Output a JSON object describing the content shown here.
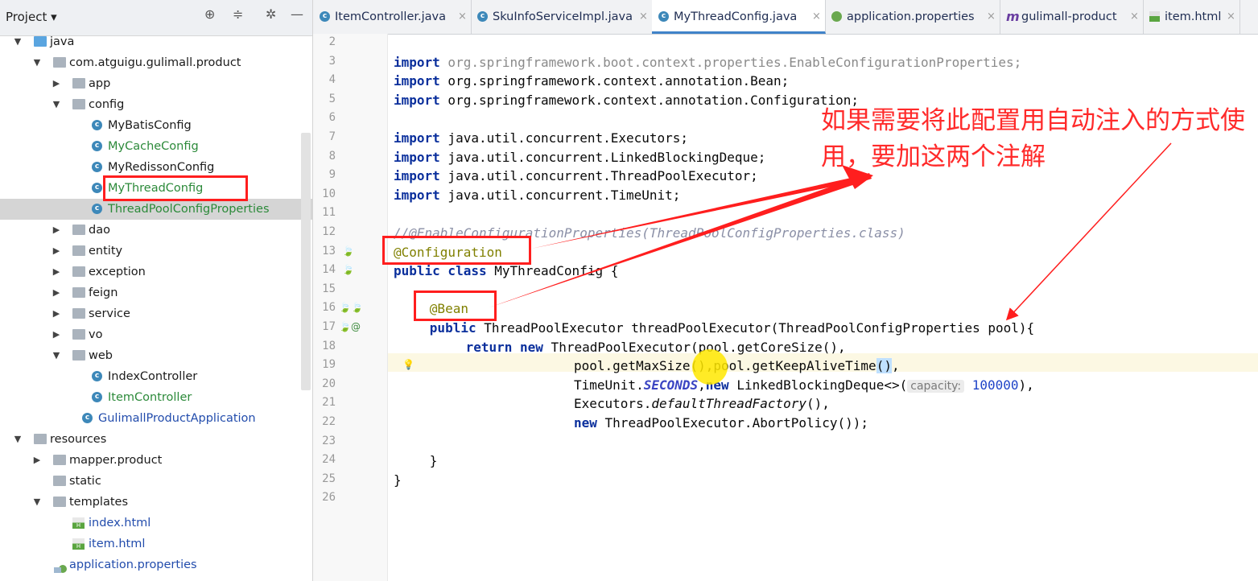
{
  "project_panel": {
    "title": "Project ▾",
    "tree": [
      {
        "label": "java",
        "depth": 1,
        "kind": "folder-blue",
        "arrow": "open"
      },
      {
        "label": "com.atguigu.gulimall.product",
        "depth": 2,
        "kind": "package",
        "arrow": "open"
      },
      {
        "label": "app",
        "depth": 3,
        "kind": "package",
        "arrow": "closed"
      },
      {
        "label": "config",
        "depth": 3,
        "kind": "package",
        "arrow": "open"
      },
      {
        "label": "MyBatisConfig",
        "depth": 4,
        "kind": "class"
      },
      {
        "label": "MyCacheConfig",
        "depth": 4,
        "kind": "class",
        "color": "green"
      },
      {
        "label": "MyRedissonConfig",
        "depth": 4,
        "kind": "class"
      },
      {
        "label": "MyThreadConfig",
        "depth": 4,
        "kind": "class",
        "color": "green"
      },
      {
        "label": "ThreadPoolConfigProperties",
        "depth": 4,
        "kind": "class",
        "color": "green",
        "selected": true
      },
      {
        "label": "dao",
        "depth": 3,
        "kind": "package",
        "arrow": "closed"
      },
      {
        "label": "entity",
        "depth": 3,
        "kind": "package",
        "arrow": "closed"
      },
      {
        "label": "exception",
        "depth": 3,
        "kind": "package",
        "arrow": "closed"
      },
      {
        "label": "feign",
        "depth": 3,
        "kind": "package",
        "arrow": "closed"
      },
      {
        "label": "service",
        "depth": 3,
        "kind": "package",
        "arrow": "closed"
      },
      {
        "label": "vo",
        "depth": 3,
        "kind": "package",
        "arrow": "closed"
      },
      {
        "label": "web",
        "depth": 3,
        "kind": "package",
        "arrow": "open"
      },
      {
        "label": "IndexController",
        "depth": 4,
        "kind": "class"
      },
      {
        "label": "ItemController",
        "depth": 4,
        "kind": "class",
        "color": "green"
      },
      {
        "label": "GulimallProductApplication",
        "depth": 3.5,
        "kind": "class",
        "color": "blue"
      },
      {
        "label": "resources",
        "depth": 1,
        "kind": "folder",
        "arrow": "open"
      },
      {
        "label": "mapper.product",
        "depth": 2,
        "kind": "package",
        "arrow": "closed"
      },
      {
        "label": "static",
        "depth": 2,
        "kind": "package"
      },
      {
        "label": "templates",
        "depth": 2,
        "kind": "package",
        "arrow": "open"
      },
      {
        "label": "index.html",
        "depth": 3,
        "kind": "html",
        "color": "blue"
      },
      {
        "label": "item.html",
        "depth": 3,
        "kind": "html",
        "color": "blue"
      },
      {
        "label": "application.properties",
        "depth": 2,
        "kind": "properties",
        "color": "blue"
      }
    ]
  },
  "tabs": [
    {
      "label": "ItemController.java",
      "icon": "class-icon"
    },
    {
      "label": "SkuInfoServiceImpl.java",
      "icon": "class-icon"
    },
    {
      "label": "MyThreadConfig.java",
      "icon": "class-icon",
      "active": true
    },
    {
      "label": "application.properties",
      "icon": "properties-icon"
    },
    {
      "label": "gulimall-product",
      "icon": "maven-icon"
    },
    {
      "label": "item.html",
      "icon": "html-icon"
    }
  ],
  "editor": {
    "line_numbers": [
      "2",
      "3",
      "4",
      "5",
      "6",
      "7",
      "8",
      "9",
      "10",
      "11",
      "12",
      "13",
      "14",
      "15",
      "16",
      "17",
      "18",
      "19",
      "20",
      "21",
      "22",
      "23",
      "24",
      "25",
      "26"
    ],
    "code": [
      {
        "kw": "",
        "text": ""
      },
      {
        "kw": "import",
        "text": " org.springframework.boot.context.properties.EnableConfigurationProperties;",
        "grey": true
      },
      {
        "kw": "import",
        "text": " org.springframework.context.annotation.",
        "tail": "Bean",
        "end": ";"
      },
      {
        "kw": "import",
        "text": " org.springframework.context.annotation.",
        "tail": "Configuration",
        "end": ";"
      },
      {
        "kw": "",
        "text": ""
      },
      {
        "kw": "import",
        "text": " java.util.concurrent.Executors;"
      },
      {
        "kw": "import",
        "text": " java.util.concurrent.LinkedBlockingDeque;"
      },
      {
        "kw": "import",
        "text": " java.util.concurrent.ThreadPoolExecutor;"
      },
      {
        "kw": "import",
        "text": " java.util.concurrent.TimeUnit;"
      },
      {
        "kw": "",
        "text": ""
      },
      {
        "comment": "//@EnableConfigurationProperties(ThreadPoolConfigProperties.class)"
      },
      {
        "annotation": "@Configuration"
      },
      {
        "kw": "public class",
        "text": " MyThreadConfig {"
      },
      {
        "kw": "",
        "text": ""
      },
      {
        "annotation": "@Bean",
        "indent": 4
      },
      {
        "kw": "public",
        "text": " ThreadPoolExecutor threadPoolExecutor(ThreadPoolConfigProperties pool){",
        "indent": 4
      },
      {
        "kw": "return new",
        "text": " ThreadPoolExecutor(pool.getCoreSize(),",
        "indent": 8
      },
      {
        "kw": "",
        "text": "pool.getMaxSize(),pool.getKeepAliveTime",
        "bracket": "()",
        "end": ",",
        "indent": 20
      },
      {
        "kw": "",
        "text": "TimeUnit.",
        "static": "SECONDS",
        "mid": ",",
        "kw2": "new",
        "text2": " LinkedBlockingDeque<>(",
        "hint": "capacity:",
        "num": "100000",
        "end": "),",
        "indent": 20
      },
      {
        "kw": "",
        "text": "Executors.",
        "italic": "defaultThreadFactory",
        "end": "(),",
        "indent": 20
      },
      {
        "kw": "new",
        "text": " ThreadPoolExecutor.AbortPolicy());",
        "indent": 20
      },
      {
        "kw": "",
        "text": ""
      },
      {
        "kw": "",
        "text": "}",
        "indent": 4
      },
      {
        "kw": "",
        "text": "}"
      },
      {
        "kw": "",
        "text": ""
      }
    ]
  },
  "annotation_text": "如果需要将此配置用自动注入的方式使用，要加这两个注解",
  "colors": {
    "annotation_red": "#ff1e1e",
    "tab_active_underline": "#4083c9",
    "cursor_highlight": "#ffe800"
  }
}
